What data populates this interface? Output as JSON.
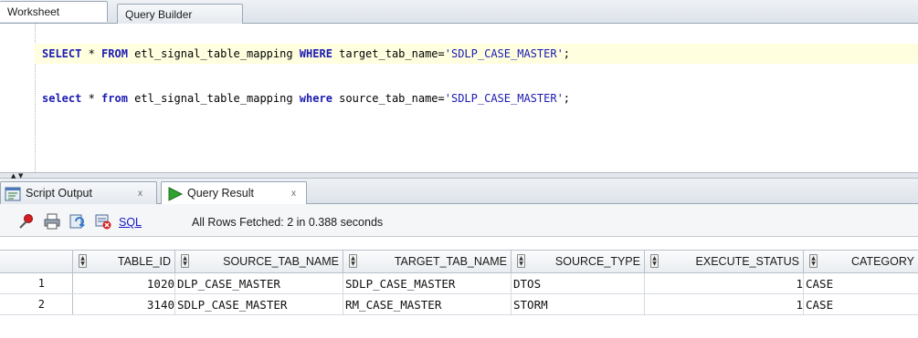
{
  "editor_tabs": [
    "Worksheet",
    "Query Builder"
  ],
  "sql": {
    "line1": {
      "kw_select": "SELECT",
      "star": " * ",
      "kw_from": "FROM",
      "table": " etl_signal_table_mapping ",
      "kw_where": "WHERE",
      "condition": " target_tab_name=",
      "value": "'SDLP_CASE_MASTER'",
      "end": ";"
    },
    "line2": {
      "kw_select": "select",
      "star": " * ",
      "kw_from": "from",
      "table": " etl_signal_table_mapping ",
      "kw_where": "where",
      "condition": " source_tab_name=",
      "value": "'SDLP_CASE_MASTER'",
      "end": ";"
    }
  },
  "result_tabs": {
    "script_output": "Script Output",
    "query_result": "Query Result",
    "close_glyph": "x"
  },
  "toolbar": {
    "sql_link": "SQL",
    "status": "All Rows Fetched: 2 in 0.388 seconds"
  },
  "grid": {
    "columns": [
      "TABLE_ID",
      "SOURCE_TAB_NAME",
      "TARGET_TAB_NAME",
      "SOURCE_TYPE",
      "EXECUTE_STATUS",
      "CATEGORY"
    ],
    "rows": [
      {
        "num": "1",
        "cells": [
          "1020",
          "DLP_CASE_MASTER",
          "SDLP_CASE_MASTER",
          "DTOS",
          "1",
          "CASE"
        ]
      },
      {
        "num": "2",
        "cells": [
          "3140",
          "SDLP_CASE_MASTER",
          "RM_CASE_MASTER",
          "STORM",
          "1",
          "CASE"
        ]
      }
    ]
  },
  "colors": {
    "keyword": "#1b1bb3",
    "current_line": "#ffffe0",
    "link": "#1515c8",
    "run_green": "#2fa32f"
  },
  "icons": [
    "splitter-up-icon",
    "splitter-down-icon",
    "script-output-icon",
    "run-triangle-icon",
    "pin-icon",
    "print-icon",
    "refresh-icon",
    "delete-icon",
    "sort-icon"
  ]
}
